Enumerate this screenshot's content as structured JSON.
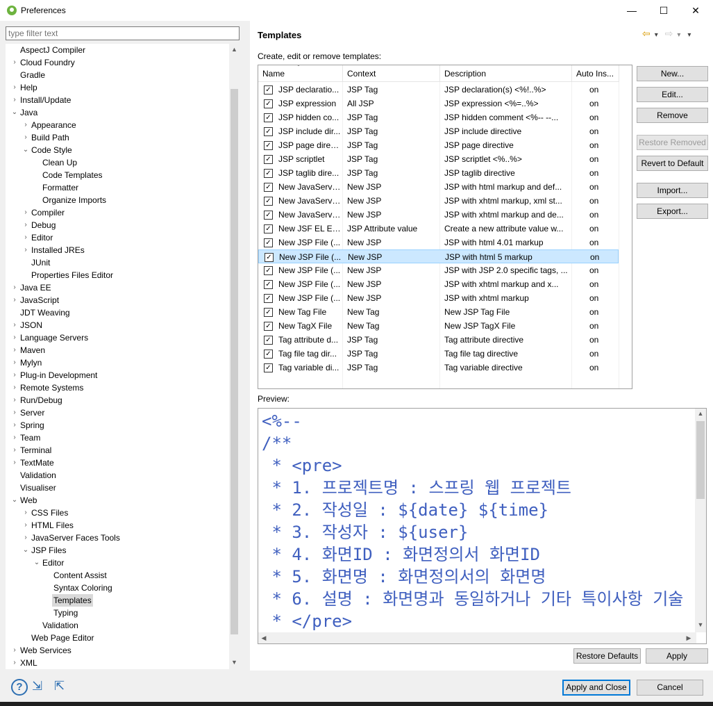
{
  "window": {
    "title": "Preferences",
    "minimize": "—",
    "maximize": "☐",
    "close": "✕"
  },
  "filter": {
    "placeholder": "type filter text"
  },
  "tree": [
    {
      "label": "AspectJ Compiler",
      "indent": 0,
      "arrow": ""
    },
    {
      "label": "Cloud Foundry",
      "indent": 0,
      "arrow": "›"
    },
    {
      "label": "Gradle",
      "indent": 0,
      "arrow": ""
    },
    {
      "label": "Help",
      "indent": 0,
      "arrow": "›"
    },
    {
      "label": "Install/Update",
      "indent": 0,
      "arrow": "›"
    },
    {
      "label": "Java",
      "indent": 0,
      "arrow": "⌄"
    },
    {
      "label": "Appearance",
      "indent": 1,
      "arrow": "›"
    },
    {
      "label": "Build Path",
      "indent": 1,
      "arrow": "›"
    },
    {
      "label": "Code Style",
      "indent": 1,
      "arrow": "⌄"
    },
    {
      "label": "Clean Up",
      "indent": 2,
      "arrow": ""
    },
    {
      "label": "Code Templates",
      "indent": 2,
      "arrow": ""
    },
    {
      "label": "Formatter",
      "indent": 2,
      "arrow": ""
    },
    {
      "label": "Organize Imports",
      "indent": 2,
      "arrow": ""
    },
    {
      "label": "Compiler",
      "indent": 1,
      "arrow": "›"
    },
    {
      "label": "Debug",
      "indent": 1,
      "arrow": "›"
    },
    {
      "label": "Editor",
      "indent": 1,
      "arrow": "›"
    },
    {
      "label": "Installed JREs",
      "indent": 1,
      "arrow": "›"
    },
    {
      "label": "JUnit",
      "indent": 1,
      "arrow": ""
    },
    {
      "label": "Properties Files Editor",
      "indent": 1,
      "arrow": ""
    },
    {
      "label": "Java EE",
      "indent": 0,
      "arrow": "›"
    },
    {
      "label": "JavaScript",
      "indent": 0,
      "arrow": "›"
    },
    {
      "label": "JDT Weaving",
      "indent": 0,
      "arrow": ""
    },
    {
      "label": "JSON",
      "indent": 0,
      "arrow": "›"
    },
    {
      "label": "Language Servers",
      "indent": 0,
      "arrow": "›"
    },
    {
      "label": "Maven",
      "indent": 0,
      "arrow": "›"
    },
    {
      "label": "Mylyn",
      "indent": 0,
      "arrow": "›"
    },
    {
      "label": "Plug-in Development",
      "indent": 0,
      "arrow": "›"
    },
    {
      "label": "Remote Systems",
      "indent": 0,
      "arrow": "›"
    },
    {
      "label": "Run/Debug",
      "indent": 0,
      "arrow": "›"
    },
    {
      "label": "Server",
      "indent": 0,
      "arrow": "›"
    },
    {
      "label": "Spring",
      "indent": 0,
      "arrow": "›"
    },
    {
      "label": "Team",
      "indent": 0,
      "arrow": "›"
    },
    {
      "label": "Terminal",
      "indent": 0,
      "arrow": "›"
    },
    {
      "label": "TextMate",
      "indent": 0,
      "arrow": "›"
    },
    {
      "label": "Validation",
      "indent": 0,
      "arrow": ""
    },
    {
      "label": "Visualiser",
      "indent": 0,
      "arrow": ""
    },
    {
      "label": "Web",
      "indent": 0,
      "arrow": "⌄"
    },
    {
      "label": "CSS Files",
      "indent": 1,
      "arrow": "›"
    },
    {
      "label": "HTML Files",
      "indent": 1,
      "arrow": "›"
    },
    {
      "label": "JavaServer Faces Tools",
      "indent": 1,
      "arrow": "›"
    },
    {
      "label": "JSP Files",
      "indent": 1,
      "arrow": "⌄"
    },
    {
      "label": "Editor",
      "indent": 2,
      "arrow": "⌄"
    },
    {
      "label": "Content Assist",
      "indent": 3,
      "arrow": ""
    },
    {
      "label": "Syntax Coloring",
      "indent": 3,
      "arrow": ""
    },
    {
      "label": "Templates",
      "indent": 3,
      "arrow": "",
      "selected": true
    },
    {
      "label": "Typing",
      "indent": 3,
      "arrow": ""
    },
    {
      "label": "Validation",
      "indent": 2,
      "arrow": ""
    },
    {
      "label": "Web Page Editor",
      "indent": 1,
      "arrow": ""
    },
    {
      "label": "Web Services",
      "indent": 0,
      "arrow": "›"
    },
    {
      "label": "XML",
      "indent": 0,
      "arrow": "›"
    }
  ],
  "page": {
    "title": "Templates",
    "description": "Create, edit or remove templates:",
    "nav": {
      "back": "⇦",
      "back_menu": "▾",
      "forward": "⇨",
      "forward_menu": "▾",
      "view_menu": "▾"
    }
  },
  "table": {
    "columns": [
      "Name",
      "Context",
      "Description",
      "Auto Ins..."
    ],
    "sort_indicator": "ˇ",
    "rows": [
      [
        "JSP declaratio...",
        "JSP Tag",
        "JSP declaration(s) <%!..%>",
        "on"
      ],
      [
        "JSP expression",
        "All JSP",
        "JSP expression <%=..%>",
        "on"
      ],
      [
        "JSP hidden co...",
        "JSP Tag",
        "JSP hidden comment <%-- --...",
        "on"
      ],
      [
        "JSP include dir...",
        "JSP Tag",
        "JSP include directive",
        "on"
      ],
      [
        "JSP page direc...",
        "JSP Tag",
        "JSP page directive",
        "on"
      ],
      [
        "JSP scriptlet",
        "JSP Tag",
        "JSP scriptlet <%..%>",
        "on"
      ],
      [
        "JSP taglib dire...",
        "JSP Tag",
        "JSP taglib directive",
        "on"
      ],
      [
        "New JavaServe...",
        "New JSP",
        "JSP with html markup and def...",
        "on"
      ],
      [
        "New JavaServe...",
        "New JSP",
        "JSP with xhtml markup, xml st...",
        "on"
      ],
      [
        "New JavaServe...",
        "New JSP",
        "JSP with xhtml markup and de...",
        "on"
      ],
      [
        "New JSF EL Ex...",
        "JSP Attribute value",
        "Create a new attribute value w...",
        "on"
      ],
      [
        "New JSP File (...",
        "New JSP",
        "JSP with html 4.01 markup",
        "on"
      ],
      [
        "New JSP File (...",
        "New JSP",
        "JSP with html 5 markup",
        "on"
      ],
      [
        "New JSP File (...",
        "New JSP",
        "JSP with JSP 2.0 specific tags, ...",
        "on"
      ],
      [
        "New JSP File (...",
        "New JSP",
        "JSP with xhtml markup and x...",
        "on"
      ],
      [
        "New JSP File (...",
        "New JSP",
        "JSP with xhtml markup",
        "on"
      ],
      [
        "New Tag File",
        "New Tag",
        "New JSP Tag File",
        "on"
      ],
      [
        "New TagX File",
        "New Tag",
        "New JSP TagX File",
        "on"
      ],
      [
        "Tag attribute d...",
        "JSP Tag",
        "Tag attribute directive",
        "on"
      ],
      [
        "Tag file tag dir...",
        "JSP Tag",
        "Tag file tag directive",
        "on"
      ],
      [
        "Tag variable di...",
        "JSP Tag",
        "Tag variable directive",
        "on"
      ]
    ],
    "selected_row": 12,
    "check": "✓"
  },
  "buttons": {
    "new": "New...",
    "edit": "Edit...",
    "remove": "Remove",
    "restore_removed": "Restore Removed",
    "revert": "Revert to Default",
    "import": "Import...",
    "export": "Export...",
    "restore_defaults": "Restore Defaults",
    "apply": "Apply",
    "apply_close": "Apply and Close",
    "cancel": "Cancel"
  },
  "preview": {
    "label": "Preview:",
    "lines": [
      "<%--",
      "/**",
      " * <pre>",
      " * 1. 프로젝트명 : 스프링 웹 프로젝트",
      " * 2. 작성일 : ${date} ${time}",
      " * 3. 작성자 : ${user}",
      " * 4. 화면ID : 화면정의서 화면ID",
      " * 5. 화면명 : 화면정의서의 화면명",
      " * 6. 설명 : 화면명과 동일하거나 기타 특이사항 기술",
      " * </pre>"
    ]
  },
  "scroll": {
    "up": "▲",
    "down": "▼",
    "left": "◀",
    "right": "▶"
  },
  "bottom_icons": {
    "help": "?",
    "import_prefs": "⇲",
    "export_prefs": "⇱"
  },
  "colors": {
    "accent": "#0078d7",
    "selection": "#cce8ff",
    "preview_text": "#3f5fbf"
  }
}
